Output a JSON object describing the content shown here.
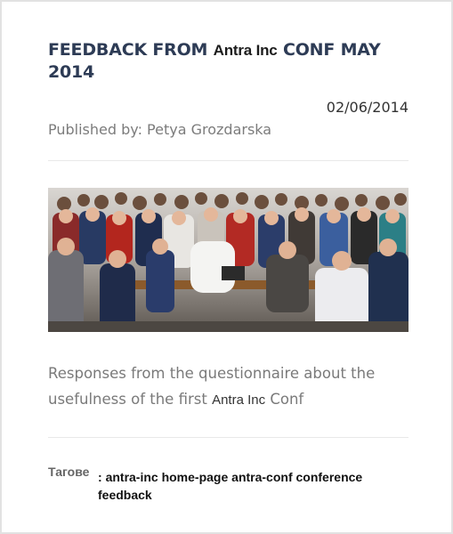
{
  "article": {
    "title_part1": "FEEDBACK FROM ",
    "title_brand": "Antra Inc",
    "title_part2": " CONF MAY 2014",
    "date": "02/06/2014",
    "published_by": "Published by: Petya Grozdarska",
    "summary_part1": "Responses from the questionnaire about the usefulness of the first ",
    "summary_brand": "Antra Inc",
    "summary_part2": "  Conf",
    "tags_label": "Тагове",
    "tags": [
      "antra-inc",
      "home-page",
      "antra-conf",
      "conference",
      "feedback"
    ]
  },
  "colors": {
    "title": "#2d3b55",
    "muted_text": "#7a7a7a",
    "card_border": "#e2e2e2"
  }
}
